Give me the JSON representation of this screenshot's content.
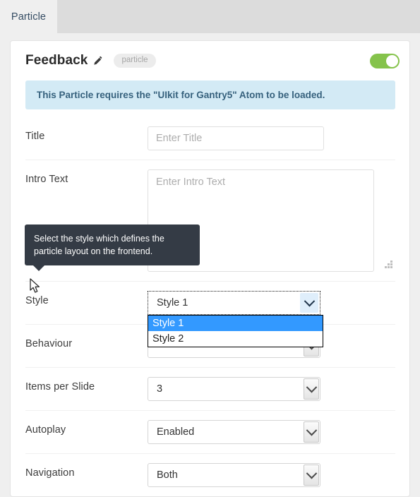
{
  "tabs": [
    {
      "label": "Particle",
      "active": true
    }
  ],
  "card": {
    "title": "Feedback",
    "edit_icon": "pencil-icon",
    "badge": "particle",
    "toggle": {
      "state": "on",
      "color": "#85c34b"
    },
    "alert": {
      "text": "This Particle requires the \"UIkit for Gantry5\" Atom to be loaded.",
      "bg_color": "#d3eaf5",
      "text_color": "#36617d"
    }
  },
  "form": {
    "rows": [
      {
        "label": "Title",
        "type": "text",
        "value": "",
        "placeholder": "Enter Title"
      },
      {
        "label": "Intro Text",
        "type": "textarea",
        "value": "",
        "placeholder": "Enter Intro Text"
      },
      {
        "label": "Style",
        "type": "select-open",
        "value": "Style 1"
      },
      {
        "label": "Behaviour",
        "type": "select",
        "value": ""
      },
      {
        "label": "Items per Slide",
        "type": "select",
        "value": "3"
      },
      {
        "label": "Autoplay",
        "type": "select",
        "value": "Enabled"
      },
      {
        "label": "Navigation",
        "type": "select",
        "value": "Both"
      }
    ]
  },
  "dropdown": {
    "options": [
      {
        "label": "Style 1",
        "selected": true
      },
      {
        "label": "Style 2",
        "selected": false
      }
    ],
    "highlight_color": "#3399ff"
  },
  "tooltip": {
    "text": "Select the style which defines the particle layout on the frontend.",
    "bg_color": "#343b45"
  }
}
